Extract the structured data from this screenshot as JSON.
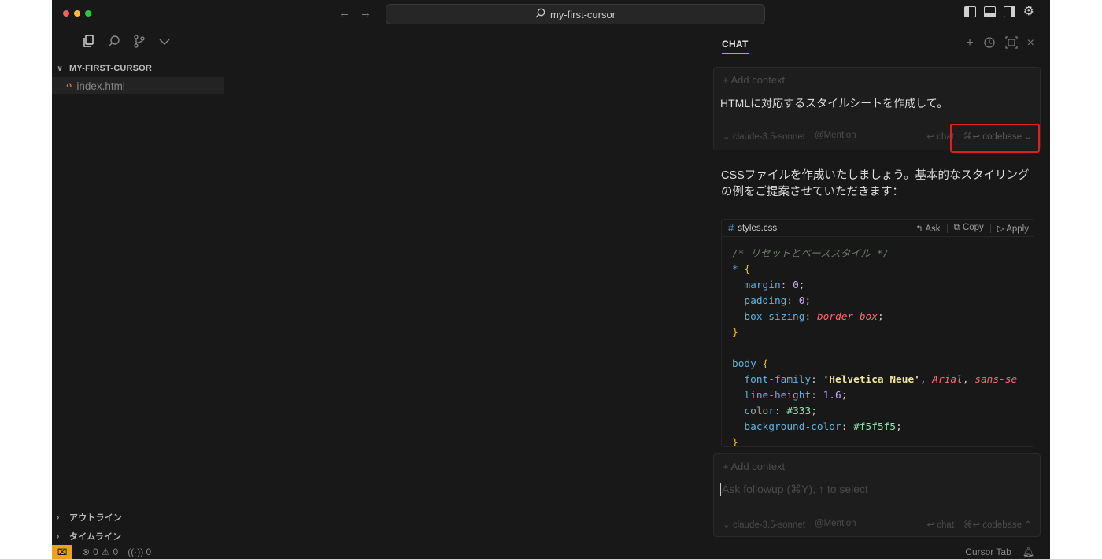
{
  "titlebar": {
    "search_text": "my-first-cursor",
    "traffic_colors": [
      "#ff5f57",
      "#febc2e",
      "#28c840"
    ]
  },
  "sidebar": {
    "project_name": "MY-FIRST-CURSOR",
    "file_name": "index.html",
    "outline_label": "アウトライン",
    "timeline_label": "タイムライン"
  },
  "chat": {
    "tab_label": "CHAT",
    "top_input": {
      "add_context": "Add context",
      "message": "HTMLに対応するスタイルシートを作成して。",
      "model": "claude-3.5-sonnet",
      "mention": "@Mention",
      "chat_btn": "chat",
      "codebase_btn": "codebase"
    },
    "ai_response": "CSSファイルを作成いたしましょう。基本的なスタイリングの例をご提案させていただきます：",
    "code_block": {
      "filename": "styles.css",
      "ask": "Ask",
      "copy": "Copy",
      "apply": "Apply",
      "comment": "/* リセットとベーススタイル */",
      "sel_star": "*",
      "sel_body": "body",
      "margin": "margin",
      "padding": "padding",
      "box_sizing": "box-sizing",
      "zero": "0",
      "border_box": "border-box",
      "font_family": "font-family",
      "helvetica": "'Helvetica Neue'",
      "arial": "Arial",
      "sans": "sans-se",
      "line_height": "line-height",
      "lh_val": "1.6",
      "color": "color",
      "color_val": "#333",
      "bg_color": "background-color",
      "bg_val": "#f5f5f5"
    },
    "bottom_input": {
      "add_context": "Add context",
      "placeholder": "Ask followup (⌘Y), ↑ to select",
      "model": "claude-3.5-sonnet",
      "mention": "@Mention",
      "chat_btn": "chat",
      "codebase_btn": "codebase"
    }
  },
  "statusbar": {
    "errors": "0",
    "warnings": "0",
    "ports": "0",
    "cursor_tab": "Cursor Tab"
  }
}
